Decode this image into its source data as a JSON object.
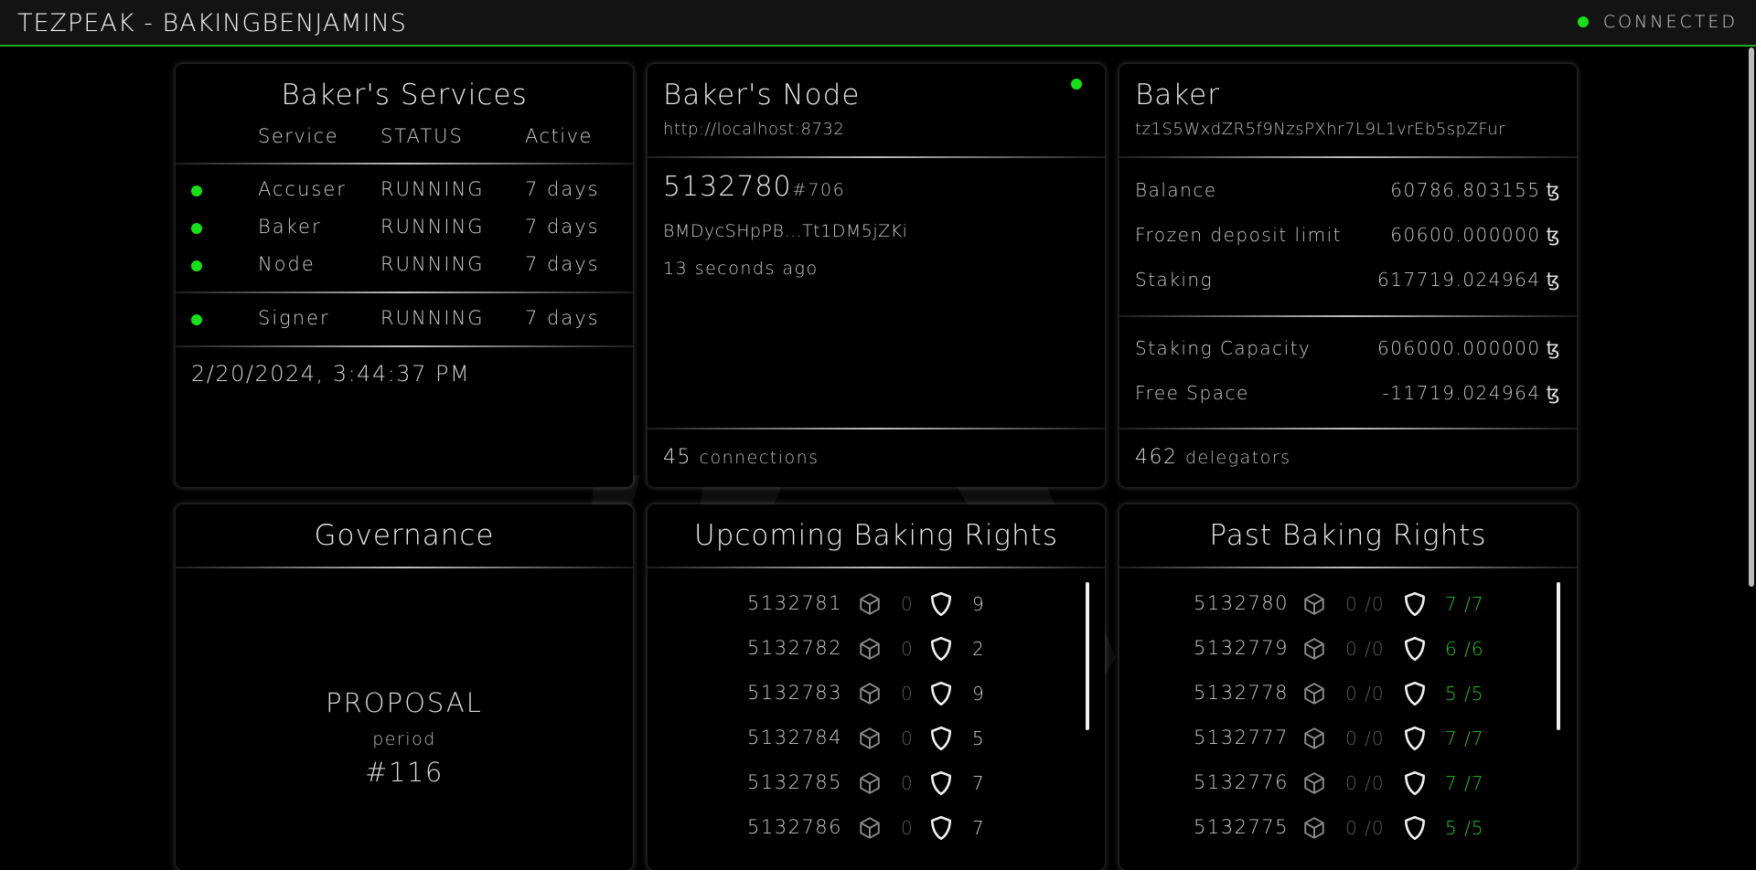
{
  "app": {
    "title": "TEZPEAK - BAKINGBENJAMINS",
    "connection_status": "CONNECTED"
  },
  "colors": {
    "accent": "#1fae1f",
    "status_ok": "#16e016",
    "rights_done": "#22c822"
  },
  "services": {
    "title": "Baker's Services",
    "headers": {
      "service": "Service",
      "status": "STATUS",
      "active": "Active"
    },
    "rows": [
      {
        "name": "Accuser",
        "status": "RUNNING",
        "active": "7 days"
      },
      {
        "name": "Baker",
        "status": "RUNNING",
        "active": "7 days"
      },
      {
        "name": "Node",
        "status": "RUNNING",
        "active": "7 days"
      },
      {
        "name": "Signer",
        "status": "RUNNING",
        "active": "7 days"
      }
    ],
    "timestamp": "2/20/2024, 3:44:37 PM"
  },
  "node": {
    "title": "Baker's Node",
    "url": "http://localhost:8732",
    "level": "5132780",
    "cycle": "#706",
    "block_hash": "BMDycSHpPB...Tt1DM5jZKi",
    "time_ago": "13 seconds ago",
    "connections_count": "45",
    "connections_label": "connections"
  },
  "baker": {
    "title": "Baker",
    "address": "tz1S5WxdZR5f9NzsPXhr7L9L1vrEb5spZFur",
    "balance_label": "Balance",
    "balance": "60786.803155",
    "frozen_label": "Frozen deposit limit",
    "frozen": "60600.000000",
    "staking_label": "Staking",
    "staking": "617719.024964",
    "capacity_label": "Staking Capacity",
    "capacity": "606000.000000",
    "free_label": "Free Space",
    "free": "-11719.024964",
    "currency_symbol": "ꜩ",
    "delegators_count": "462",
    "delegators_label": "delegators"
  },
  "governance": {
    "title": "Governance",
    "phase": "PROPOSAL",
    "period_label": "period",
    "period_number": "#116"
  },
  "upcoming": {
    "title": "Upcoming Baking Rights",
    "rows": [
      {
        "level": "5132781",
        "blocks": "0",
        "attestations": "9"
      },
      {
        "level": "5132782",
        "blocks": "0",
        "attestations": "2"
      },
      {
        "level": "5132783",
        "blocks": "0",
        "attestations": "9"
      },
      {
        "level": "5132784",
        "blocks": "0",
        "attestations": "5"
      },
      {
        "level": "5132785",
        "blocks": "0",
        "attestations": "7"
      },
      {
        "level": "5132786",
        "blocks": "0",
        "attestations": "7"
      }
    ]
  },
  "past": {
    "title": "Past Baking Rights",
    "rows": [
      {
        "level": "5132780",
        "blocks": "0 /0",
        "attestations": "7 /7"
      },
      {
        "level": "5132779",
        "blocks": "0 /0",
        "attestations": "6 /6"
      },
      {
        "level": "5132778",
        "blocks": "0 /0",
        "attestations": "5 /5"
      },
      {
        "level": "5132777",
        "blocks": "0 /0",
        "attestations": "7 /7"
      },
      {
        "level": "5132776",
        "blocks": "0 /0",
        "attestations": "7 /7"
      },
      {
        "level": "5132775",
        "blocks": "0 /0",
        "attestations": "5 /5"
      }
    ]
  }
}
